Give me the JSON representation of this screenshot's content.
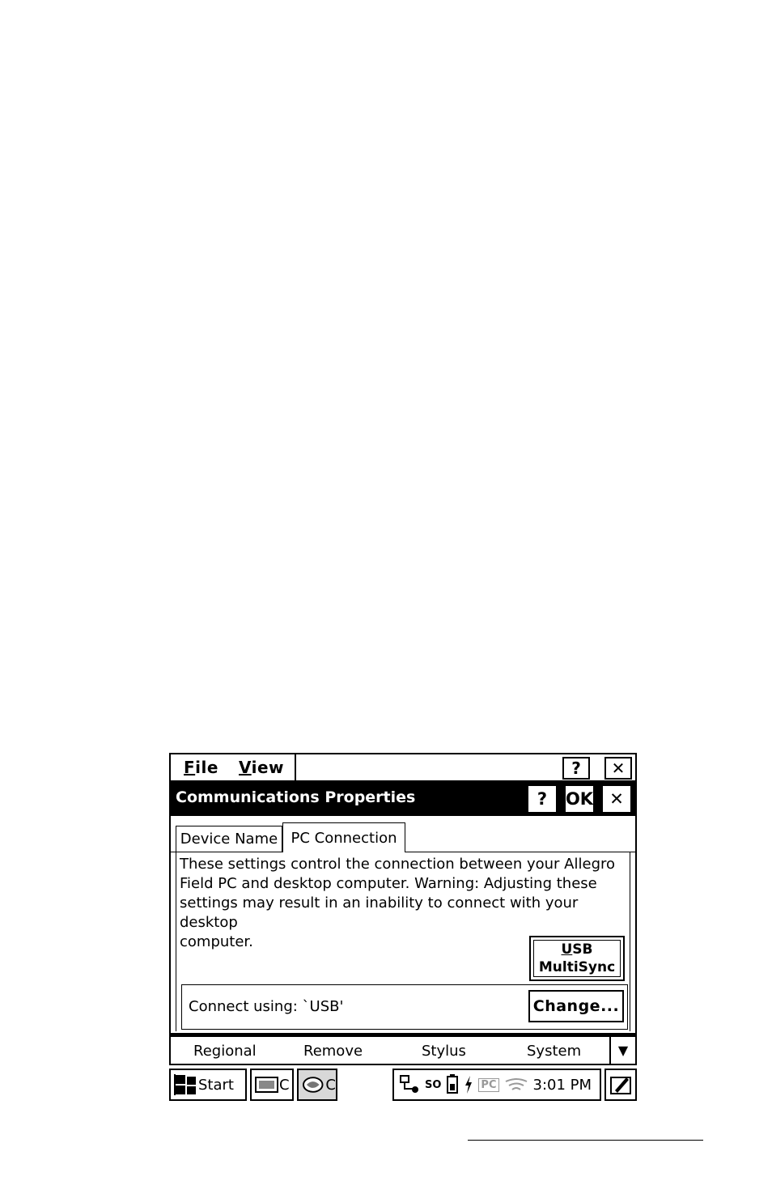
{
  "menubar": {
    "file_label": "File",
    "view_label": "View",
    "help_label": "?",
    "close_label": "✕"
  },
  "dialog": {
    "title": "Communications Properties",
    "help_label": "?",
    "ok_label": "OK",
    "close_label": "✕",
    "tabs": [
      {
        "label": "Device Name",
        "active": false
      },
      {
        "label": "PC Connection",
        "active": true
      }
    ],
    "description_lines": [
      "These settings control the connection between your Allegro",
      "Field PC and desktop computer.  Warning: Adjusting these",
      "settings may result in an inability to connect with your desktop",
      "computer."
    ],
    "usb_button_line1": "USB",
    "usb_button_line2": "MultiSync",
    "connect_label": "Connect using:   `USB'",
    "change_label": "Change..."
  },
  "strip": {
    "items": [
      "Regional",
      "Remove",
      "Stylus",
      "System"
    ],
    "more_arrow": "▼"
  },
  "taskbar": {
    "start_label": "Start",
    "task1_label": "C",
    "task2_label": "C",
    "clock": "3:01 PM",
    "tray_pc": "PC",
    "tray_so": "SO"
  }
}
